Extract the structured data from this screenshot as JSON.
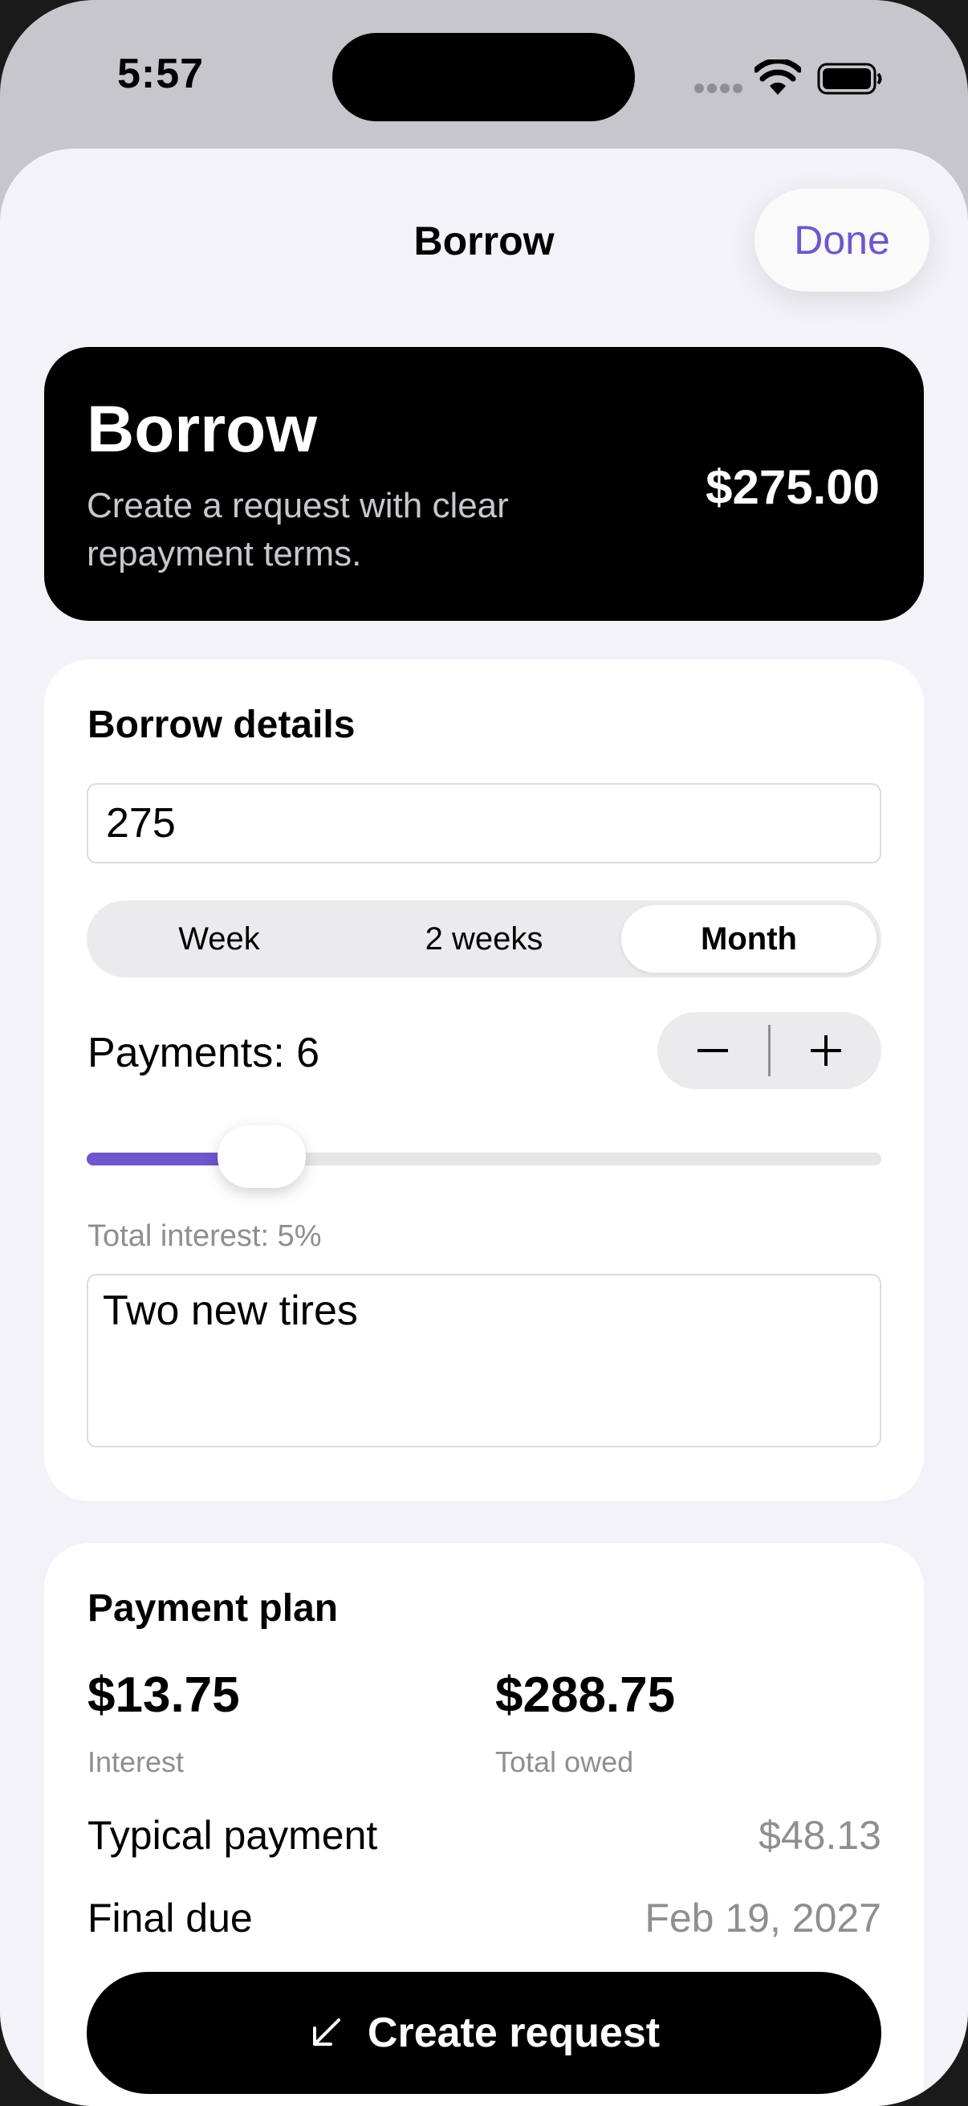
{
  "status_bar": {
    "time": "5:57"
  },
  "nav": {
    "title": "Borrow",
    "done_label": "Done"
  },
  "hero": {
    "title": "Borrow",
    "subtitle": "Create a request with clear repayment terms.",
    "amount": "$275.00"
  },
  "details": {
    "heading": "Borrow details",
    "amount_value": "275",
    "frequency_options": [
      "Week",
      "2 weeks",
      "Month"
    ],
    "selected_frequency": "Month",
    "payments_label": "Payments: 6",
    "payments_slider_level": 0.22,
    "interest_note": "Total interest: 5%",
    "note_value": "Two new tires"
  },
  "plan": {
    "heading": "Payment plan",
    "interest_value": "$13.75",
    "interest_label": "Interest",
    "total_value": "$288.75",
    "total_label": "Total owed",
    "typical_label": "Typical payment",
    "typical_value": "$48.13",
    "final_label": "Final due",
    "final_value": "Feb 19, 2027"
  },
  "actions": {
    "create_label": "Create request"
  },
  "colors": {
    "accent": "#6e56cf",
    "primary": "#000000",
    "muted": "#8e8e93"
  },
  "icons": {
    "wifi": "wifi-icon",
    "battery": "battery-icon",
    "minus": "minus-icon",
    "plus": "plus-icon",
    "create": "arrow-down-left-icon"
  }
}
